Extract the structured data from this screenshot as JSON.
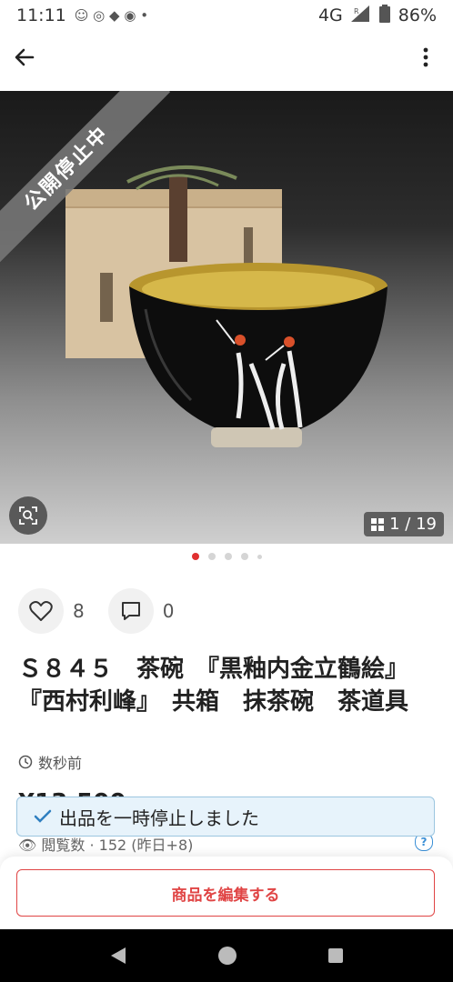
{
  "status_bar": {
    "time": "11:11",
    "network": "4G",
    "roaming": "R",
    "battery": "86%"
  },
  "header": {
    "back_icon": "arrow-left-icon",
    "menu_icon": "more-vertical-icon"
  },
  "photo": {
    "banner": "公開停止中",
    "counter": "1 / 19",
    "dots_total": 5,
    "dots_active": 0
  },
  "social": {
    "likes": "8",
    "comments": "0"
  },
  "item": {
    "title": "Ｓ８４５　茶碗　『黒釉内金立鶴絵』『西村利峰』　共箱　抹茶碗　茶道具",
    "posted": "数秒前",
    "price_peek": "¥13,500",
    "views": "閲覧数 · 152 (昨日+8)"
  },
  "toast": {
    "message": "出品を一時停止しました"
  },
  "actions": {
    "edit_label": "商品を編集する"
  },
  "colors": {
    "accent_red": "#e04545",
    "toast_bg": "#e7f3fb",
    "toast_border": "#9cc6e0"
  }
}
